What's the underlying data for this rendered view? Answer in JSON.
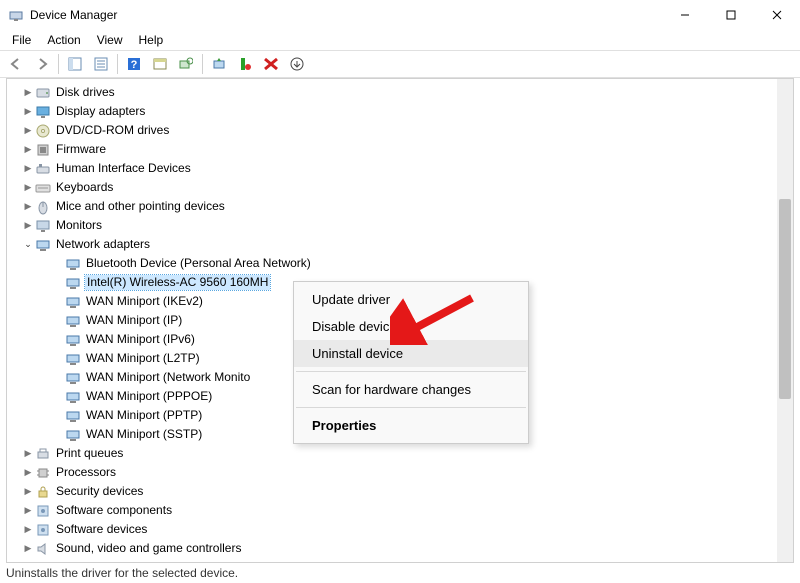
{
  "window": {
    "title": "Device Manager"
  },
  "menubar": {
    "file": "File",
    "action": "Action",
    "view": "View",
    "help": "Help"
  },
  "toolbar_icons": {
    "back": "back-icon",
    "forward": "forward-icon",
    "show_hide": "show-hide-icon",
    "properties": "properties-icon",
    "help": "help-icon",
    "action": "action-icon",
    "scan": "scan-icon",
    "update": "update-icon",
    "uninstall": "uninstall-icon",
    "disable": "disable-icon",
    "remove": "remove-icon",
    "down": "down-icon"
  },
  "tree": {
    "categories": [
      {
        "label": "Disk drives",
        "icon": "disk",
        "expanded": false
      },
      {
        "label": "Display adapters",
        "icon": "display",
        "expanded": false
      },
      {
        "label": "DVD/CD-ROM drives",
        "icon": "cdrom",
        "expanded": false
      },
      {
        "label": "Firmware",
        "icon": "firmware",
        "expanded": false
      },
      {
        "label": "Human Interface Devices",
        "icon": "hid",
        "expanded": false
      },
      {
        "label": "Keyboards",
        "icon": "keyboard",
        "expanded": false
      },
      {
        "label": "Mice and other pointing devices",
        "icon": "mouse",
        "expanded": false
      },
      {
        "label": "Monitors",
        "icon": "monitor",
        "expanded": false
      },
      {
        "label": "Network adapters",
        "icon": "network",
        "expanded": true,
        "children": [
          {
            "label": "Bluetooth Device (Personal Area Network)",
            "icon": "network",
            "selected": false
          },
          {
            "label": "Intel(R) Wireless-AC 9560 160MHz",
            "icon": "network",
            "selected": true,
            "truncated_display": "Intel(R) Wireless-AC 9560 160MH"
          },
          {
            "label": "WAN Miniport (IKEv2)",
            "icon": "network"
          },
          {
            "label": "WAN Miniport (IP)",
            "icon": "network"
          },
          {
            "label": "WAN Miniport (IPv6)",
            "icon": "network"
          },
          {
            "label": "WAN Miniport (L2TP)",
            "icon": "network"
          },
          {
            "label": "WAN Miniport (Network Monito",
            "icon": "network"
          },
          {
            "label": "WAN Miniport (PPPOE)",
            "icon": "network"
          },
          {
            "label": "WAN Miniport (PPTP)",
            "icon": "network"
          },
          {
            "label": "WAN Miniport (SSTP)",
            "icon": "network"
          }
        ]
      },
      {
        "label": "Print queues",
        "icon": "printer",
        "expanded": false
      },
      {
        "label": "Processors",
        "icon": "cpu",
        "expanded": false
      },
      {
        "label": "Security devices",
        "icon": "security",
        "expanded": false
      },
      {
        "label": "Software components",
        "icon": "software",
        "expanded": false
      },
      {
        "label": "Software devices",
        "icon": "software",
        "expanded": false
      },
      {
        "label": "Sound, video and game controllers",
        "icon": "sound",
        "expanded": false
      }
    ]
  },
  "context_menu": {
    "items": [
      {
        "label": "Update driver",
        "type": "item"
      },
      {
        "label": "Disable device",
        "type": "item"
      },
      {
        "label": "Uninstall device",
        "type": "item",
        "hovered": true
      },
      {
        "type": "separator"
      },
      {
        "label": "Scan for hardware changes",
        "type": "item"
      },
      {
        "type": "separator"
      },
      {
        "label": "Properties",
        "type": "item",
        "bold": true
      }
    ]
  },
  "statusbar": {
    "text": "Uninstalls the driver for the selected device."
  },
  "annotation": {
    "arrow_points_to": "Uninstall device"
  }
}
